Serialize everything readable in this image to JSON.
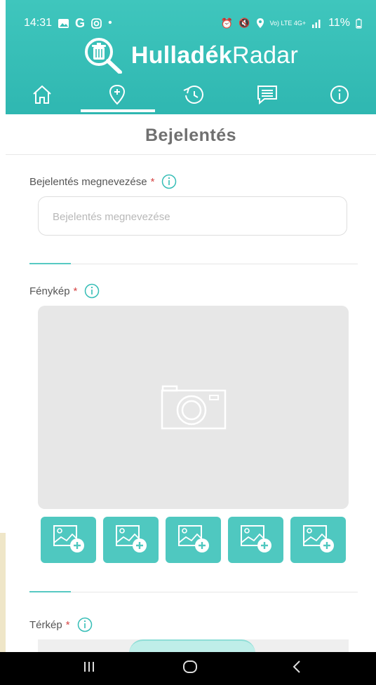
{
  "status": {
    "time": "14:31",
    "left_icons": [
      "gallery-icon",
      "google-icon",
      "instagram-icon",
      "dot-icon"
    ],
    "right_icons": [
      "alarm-icon",
      "mute-icon",
      "location-icon",
      "volte-icon",
      "signal-icon"
    ],
    "network": "Vo) LTE 4G+",
    "battery": "11%"
  },
  "brand": {
    "name_bold": "Hulladék",
    "name_light": "Radar"
  },
  "nav": {
    "tabs": [
      {
        "id": "home",
        "icon": "home-icon"
      },
      {
        "id": "report",
        "icon": "location-plus-icon",
        "active": true
      },
      {
        "id": "history",
        "icon": "history-icon"
      },
      {
        "id": "messages",
        "icon": "message-icon"
      },
      {
        "id": "info",
        "icon": "info-icon"
      }
    ]
  },
  "page": {
    "title": "Bejelentés"
  },
  "form": {
    "name_label": "Bejelentés megnevezése",
    "name_placeholder": "Bejelentés megnevezése",
    "name_value": "",
    "photo_label": "Fénykép",
    "map_label": "Térkép",
    "required_mark": "*",
    "thumbnail_count": 5
  },
  "system_nav": {
    "icons": [
      "recent-apps-icon",
      "home-button-icon",
      "back-icon"
    ]
  },
  "colors": {
    "teal": "#38c0b8",
    "thumb": "#4fc8c0",
    "required": "#d64545",
    "text": "#555555",
    "photo_bg": "#e7e7e7"
  }
}
